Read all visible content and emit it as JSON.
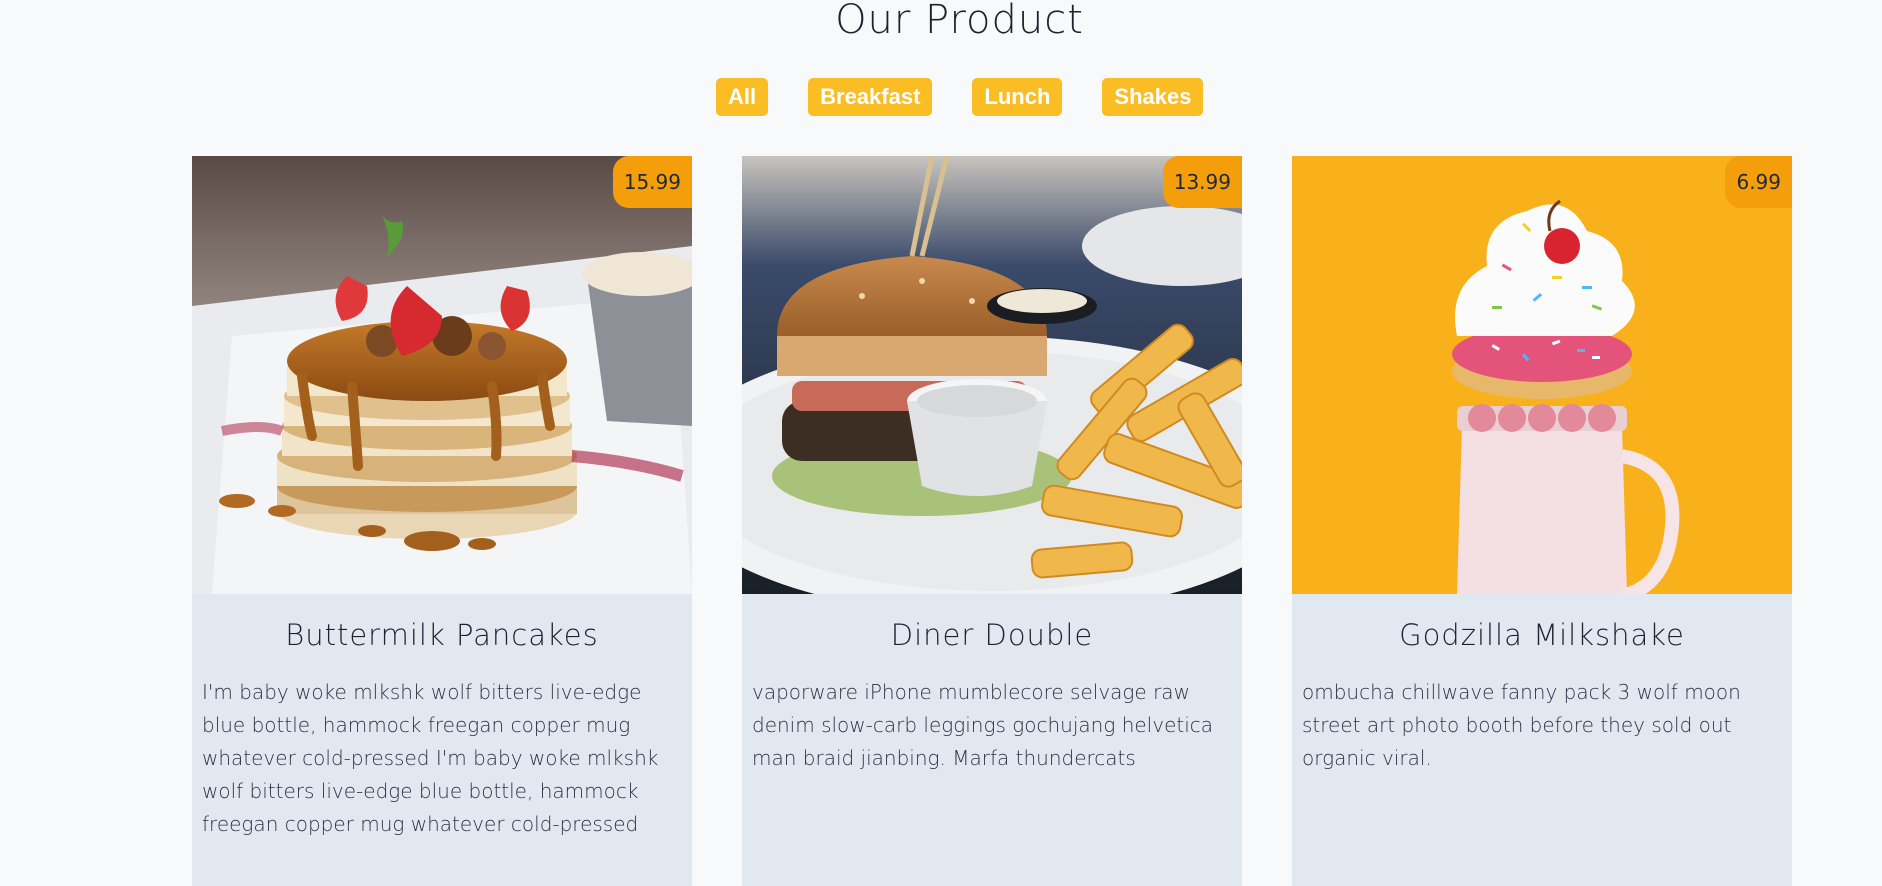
{
  "page_title": "Our Product",
  "filters": [
    "All",
    "Breakfast",
    "Lunch",
    "Shakes"
  ],
  "products": [
    {
      "name": "Buttermilk Pancakes",
      "price": "15.99",
      "description": "I'm baby woke mlkshk wolf bitters live-edge blue bottle, hammock freegan copper mug whatever cold-pressed I'm baby woke mlkshk wolf bitters live-edge blue bottle, hammock freegan copper mug whatever cold-pressed",
      "image": "pancakes-photo"
    },
    {
      "name": "Diner Double",
      "price": "13.99",
      "description": "vaporware iPhone mumblecore selvage raw denim slow-carb leggings gochujang helvetica man braid jianbing. Marfa thundercats",
      "image": "burger-photo"
    },
    {
      "name": "Godzilla Milkshake",
      "price": "6.99",
      "description": "ombucha chillwave fanny pack 3 wolf moon street art photo booth before they sold out organic viral.",
      "image": "milkshake-photo"
    }
  ],
  "colors": {
    "accent": "#fbbd24",
    "price_tag": "#f59e0b",
    "card_bg": "#e2e8f0",
    "page_bg": "#f8f9fb"
  }
}
